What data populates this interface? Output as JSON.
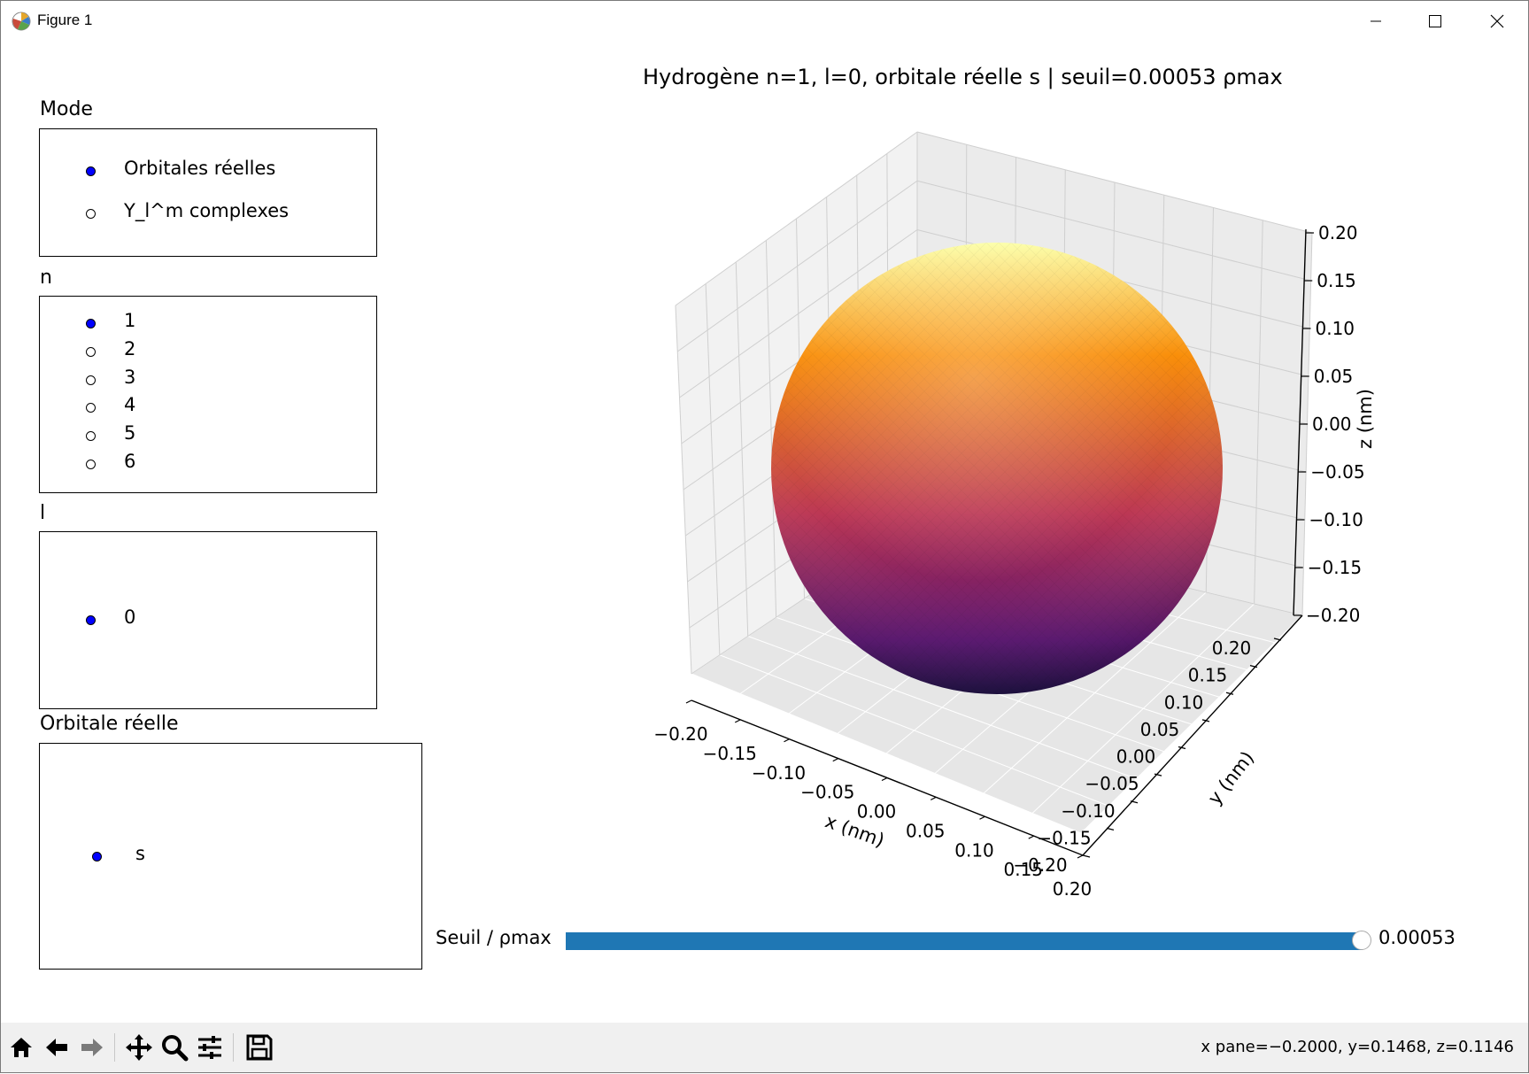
{
  "window": {
    "title": "Figure 1"
  },
  "panels": {
    "mode": {
      "title": "Mode",
      "options": [
        "Orbitales réelles",
        "Y_l^m complexes"
      ],
      "selected": 0
    },
    "n": {
      "title": "n",
      "options": [
        "1",
        "2",
        "3",
        "4",
        "5",
        "6"
      ],
      "selected": 0
    },
    "l": {
      "title": "l",
      "options": [
        "0"
      ],
      "selected": 0
    },
    "orbital": {
      "title": "Orbitale réelle",
      "options": [
        "s"
      ],
      "selected": 0
    }
  },
  "plot": {
    "title": "Hydrogène  n=1, l=0, orbitale réelle s  |  seuil=0.00053 ρmax",
    "xlabel": "x (nm)",
    "ylabel": "y (nm)",
    "zlabel": "z (nm)",
    "ticks": [
      "−0.20",
      "−0.15",
      "−0.10",
      "−0.05",
      "0.00",
      "0.05",
      "0.10",
      "0.15",
      "0.20"
    ],
    "z_ticks": [
      "0.20",
      "0.15",
      "0.10",
      "0.05",
      "0.00",
      "−0.05",
      "−0.10",
      "−0.15",
      "−0.20"
    ],
    "colormap": [
      "#fcffa4",
      "#f98e09",
      "#bc3754",
      "#57106e",
      "#000004"
    ]
  },
  "slider": {
    "label": "Seuil / ρmax",
    "value_text": "0.00053",
    "fraction": 1.0,
    "color": "#1f77b4"
  },
  "toolbar": {
    "coord_text": "x pane=−0.2000, y=0.1468, z=0.1146"
  }
}
